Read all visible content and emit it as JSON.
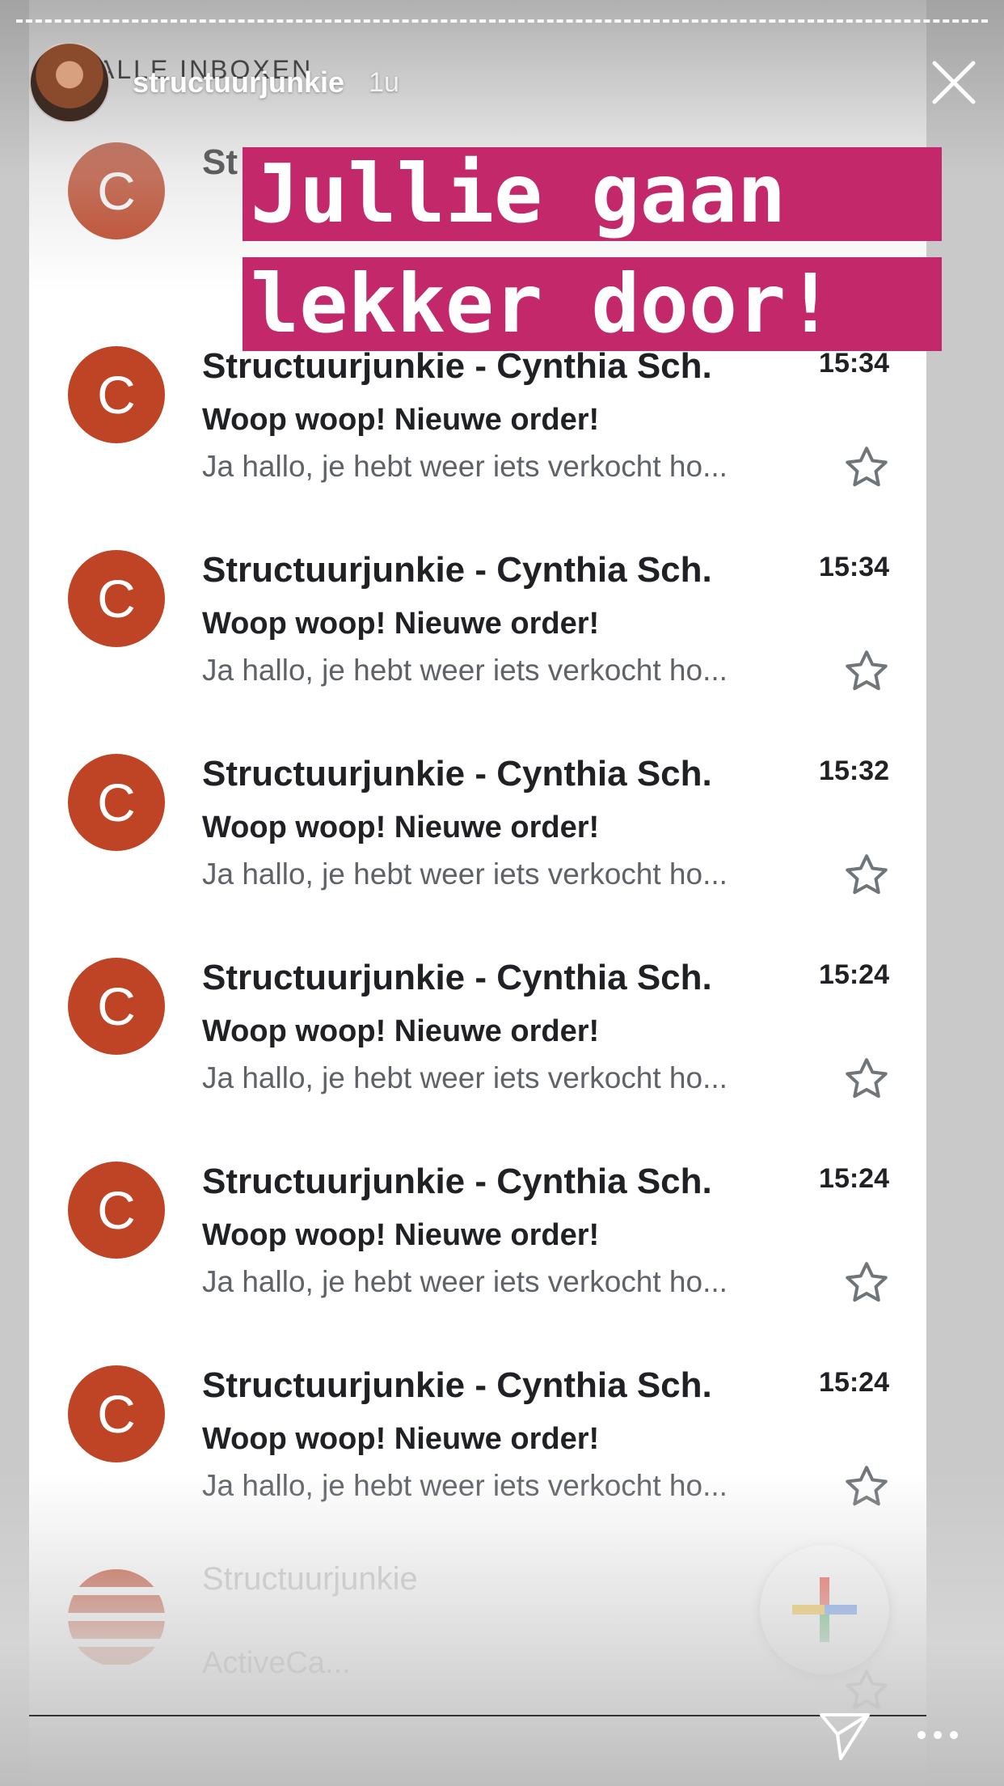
{
  "story": {
    "username": "structuurjunkie",
    "time_ago": "1u",
    "inbox_label": "ALLE INBOXEN"
  },
  "overlay": {
    "line1": "Jullie gaan",
    "line2": "lekker door!",
    "background_color": "#c2286a"
  },
  "partial_top": {
    "avatar_letter": "C",
    "sender_fragment": "St"
  },
  "emails": [
    {
      "avatar_letter": "C",
      "sender": "Structuurjunkie - Cynthia Sch.",
      "time": "15:34",
      "subject": "Woop woop! Nieuwe order!",
      "snippet": "Ja hallo, je hebt weer iets verkocht ho..."
    },
    {
      "avatar_letter": "C",
      "sender": "Structuurjunkie - Cynthia Sch.",
      "time": "15:34",
      "subject": "Woop woop! Nieuwe order!",
      "snippet": "Ja hallo, je hebt weer iets verkocht ho..."
    },
    {
      "avatar_letter": "C",
      "sender": "Structuurjunkie - Cynthia Sch.",
      "time": "15:32",
      "subject": "Woop woop! Nieuwe order!",
      "snippet": "Ja hallo, je hebt weer iets verkocht ho..."
    },
    {
      "avatar_letter": "C",
      "sender": "Structuurjunkie - Cynthia Sch.",
      "time": "15:24",
      "subject": "Woop woop! Nieuwe order!",
      "snippet": "Ja hallo, je hebt weer iets verkocht ho..."
    },
    {
      "avatar_letter": "C",
      "sender": "Structuurjunkie - Cynthia Sch.",
      "time": "15:24",
      "subject": "Woop woop! Nieuwe order!",
      "snippet": "Ja hallo, je hebt weer iets verkocht ho..."
    },
    {
      "avatar_letter": "C",
      "sender": "Structuurjunkie - Cynthia Sch.",
      "time": "15:24",
      "subject": "Woop woop! Nieuwe order!",
      "snippet": "Ja hallo, je hebt weer iets verkocht ho..."
    }
  ],
  "partial_bottom": {
    "sender_fragment": "Structuurjunkie",
    "snippet_fragment": "ActiveCa..."
  },
  "colors": {
    "avatar": "#be4425",
    "fab_red": "#ea4335",
    "fab_blue": "#4285f4",
    "fab_yellow": "#fbbc05",
    "fab_green": "#34a853"
  }
}
